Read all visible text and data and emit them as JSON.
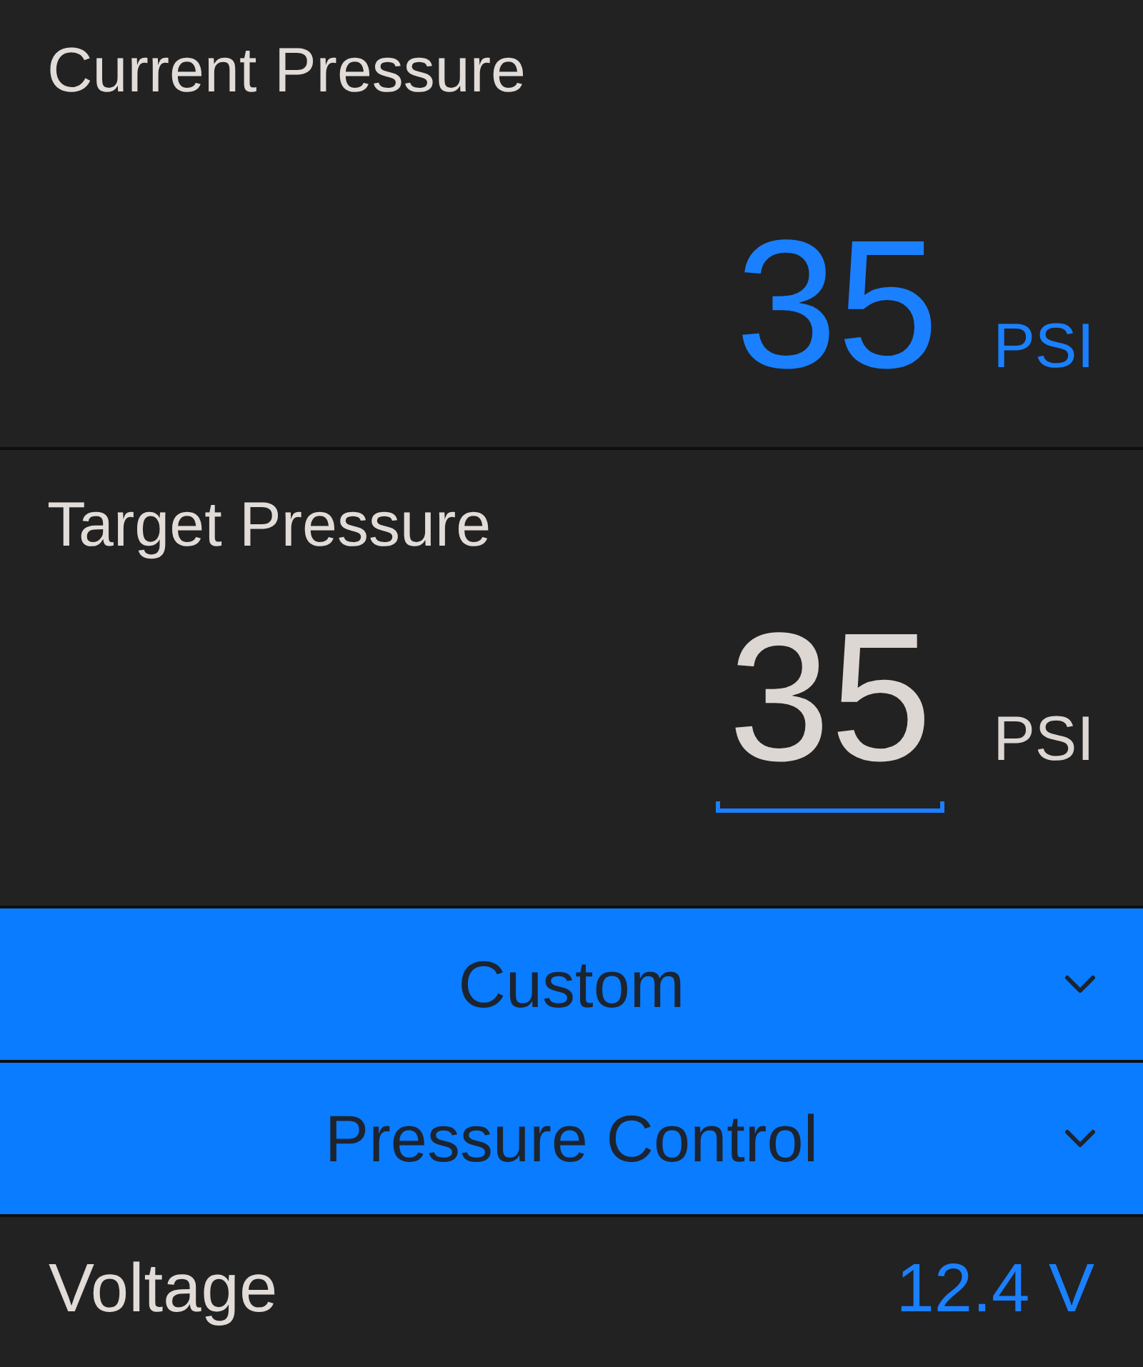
{
  "current_pressure": {
    "label": "Current Pressure",
    "value": "35",
    "unit": "PSI"
  },
  "target_pressure": {
    "label": "Target Pressure",
    "value": "35",
    "unit": "PSI"
  },
  "dropdowns": [
    {
      "value": "Custom"
    },
    {
      "value": "Pressure Control"
    }
  ],
  "voltage": {
    "label": "Voltage",
    "value": "12.4 V"
  }
}
